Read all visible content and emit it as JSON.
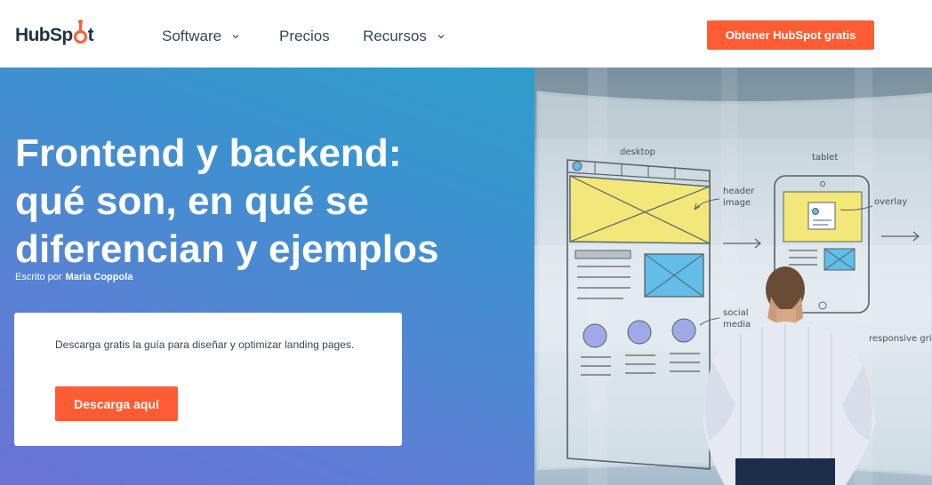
{
  "nav": {
    "logo": "HubSpot",
    "items": [
      {
        "label": "Software",
        "has_dropdown": true
      },
      {
        "label": "Precios",
        "has_dropdown": false
      },
      {
        "label": "Recursos",
        "has_dropdown": true
      }
    ],
    "cta_label": "Obtener HubSpot gratis"
  },
  "hero": {
    "title_lines": [
      "Frontend y backend:",
      "qué son, en qué se",
      "diferencian y ejemplos"
    ],
    "byline_prefix": "Escrito por",
    "author": "Maria Coppola",
    "card": {
      "text": "Descarga gratis la guía para diseñar y optimizar landing pages.",
      "button_label": "Descarga aquí"
    },
    "image": {
      "labels": {
        "desktop": "desktop",
        "tablet": "tablet",
        "header_image": "header image",
        "overlay": "overlay",
        "social_media": "social media",
        "responsive_grid": "responsive grid"
      }
    }
  },
  "colors": {
    "brand_orange": "#ff5c35",
    "text_dark": "#213343",
    "hero_gradient_start": "#25a7c9",
    "hero_gradient_end": "#6a72d3"
  }
}
